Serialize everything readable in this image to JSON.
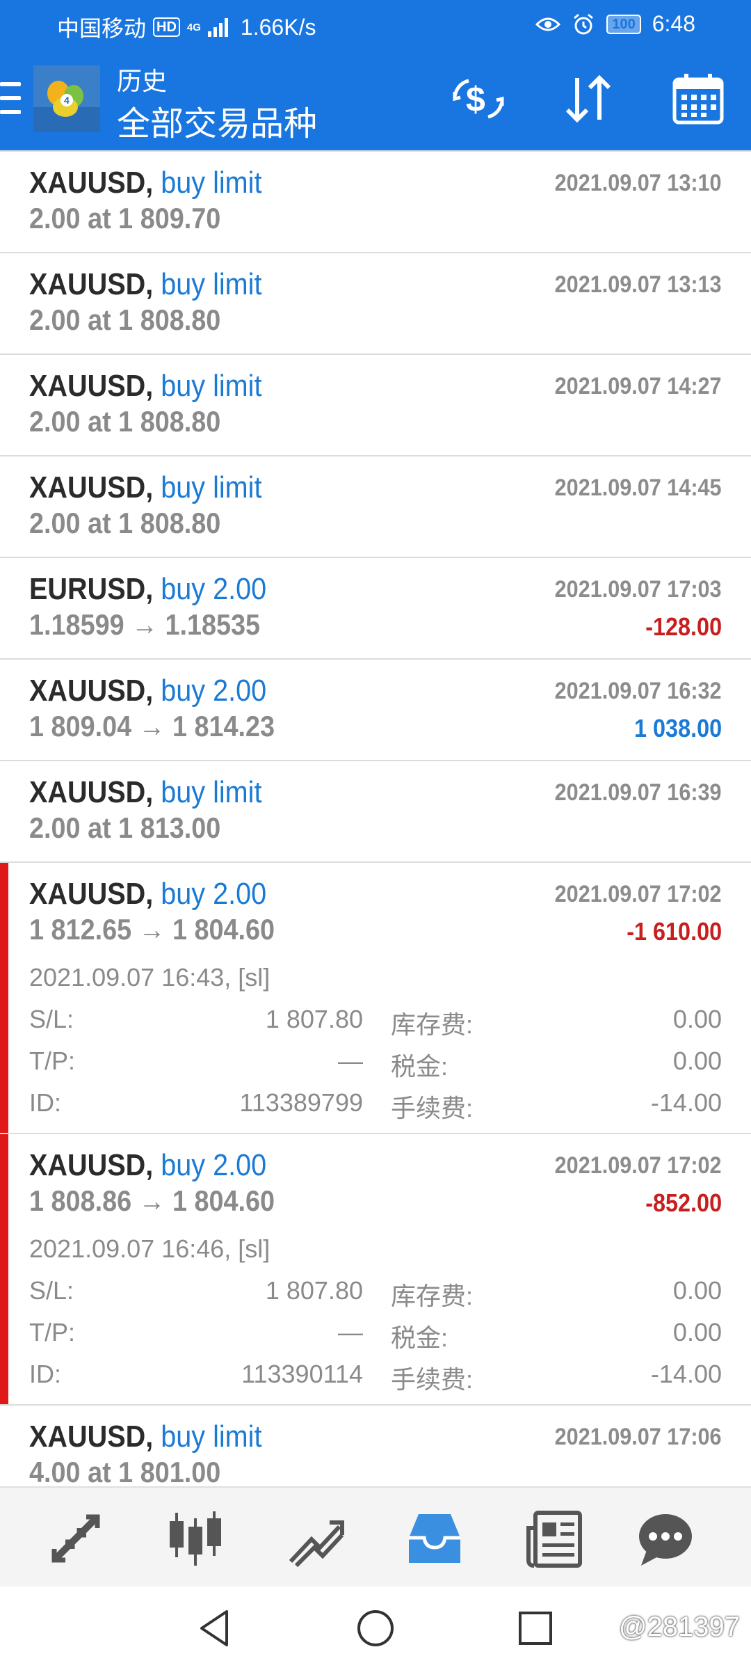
{
  "status_bar": {
    "carrier": "中国移动",
    "hd": "HD",
    "network": "4G",
    "speed": "1.66K/s",
    "battery": "100",
    "time": "6:48"
  },
  "header": {
    "subtitle": "历史",
    "title": "全部交易品种",
    "color": "#1976e0"
  },
  "trades": [
    {
      "symbol": "XAUUSD,",
      "type": "buy limit",
      "detail": "2.00 at 1 809.70",
      "time": "2021.09.07 13:10",
      "profit": ""
    },
    {
      "symbol": "XAUUSD,",
      "type": "buy limit",
      "detail": "2.00 at 1 808.80",
      "time": "2021.09.07 13:13",
      "profit": ""
    },
    {
      "symbol": "XAUUSD,",
      "type": "buy limit",
      "detail": "2.00 at 1 808.80",
      "time": "2021.09.07 14:27",
      "profit": ""
    },
    {
      "symbol": "XAUUSD,",
      "type": "buy limit",
      "detail": "2.00 at 1 808.80",
      "time": "2021.09.07 14:45",
      "profit": ""
    },
    {
      "symbol": "EURUSD,",
      "type": "buy 2.00",
      "detail": "1.18599 → 1.18535",
      "time": "2021.09.07 17:03",
      "profit": "-128.00"
    },
    {
      "symbol": "XAUUSD,",
      "type": "buy 2.00",
      "detail": "1 809.04 → 1 814.23",
      "time": "2021.09.07 16:32",
      "profit": "1 038.00"
    },
    {
      "symbol": "XAUUSD,",
      "type": "buy limit",
      "detail": "2.00 at 1 813.00",
      "time": "2021.09.07 16:39",
      "profit": ""
    },
    {
      "symbol": "XAUUSD,",
      "type": "buy 2.00",
      "detail": "1 812.65 → 1 804.60",
      "time": "2021.09.07 17:02",
      "profit": "-1 610.00",
      "open": "2021.09.07 16:43, [sl]",
      "sl_label": "S/L:",
      "sl": "1 807.80",
      "swap_label": "库存费:",
      "swap": "0.00",
      "tp_label": "T/P:",
      "tp": "—",
      "tax_label": "税金:",
      "tax": "0.00",
      "id_label": "ID:",
      "id": "113389799",
      "commission_label": "手续费:",
      "commission": "-14.00"
    },
    {
      "symbol": "XAUUSD,",
      "type": "buy 2.00",
      "detail": "1 808.86 → 1 804.60",
      "time": "2021.09.07 17:02",
      "profit": "-852.00",
      "open": "2021.09.07 16:46, [sl]",
      "sl_label": "S/L:",
      "sl": "1 807.80",
      "swap_label": "库存费:",
      "swap": "0.00",
      "tp_label": "T/P:",
      "tp": "—",
      "tax_label": "税金:",
      "tax": "0.00",
      "id_label": "ID:",
      "id": "113390114",
      "commission_label": "手续费:",
      "commission": "-14.00"
    },
    {
      "symbol": "XAUUSD,",
      "type": "buy limit",
      "detail": "4.00 at 1 801.00",
      "time": "2021.09.07 17:06",
      "profit": ""
    }
  ],
  "bottom_nav": {
    "items": [
      "quotes-icon",
      "chart-icon",
      "trade-icon",
      "history-icon",
      "news-icon",
      "chat-icon"
    ],
    "active_color": "#3a8fe0",
    "inactive_color": "#555555"
  },
  "watermark": "@281397"
}
